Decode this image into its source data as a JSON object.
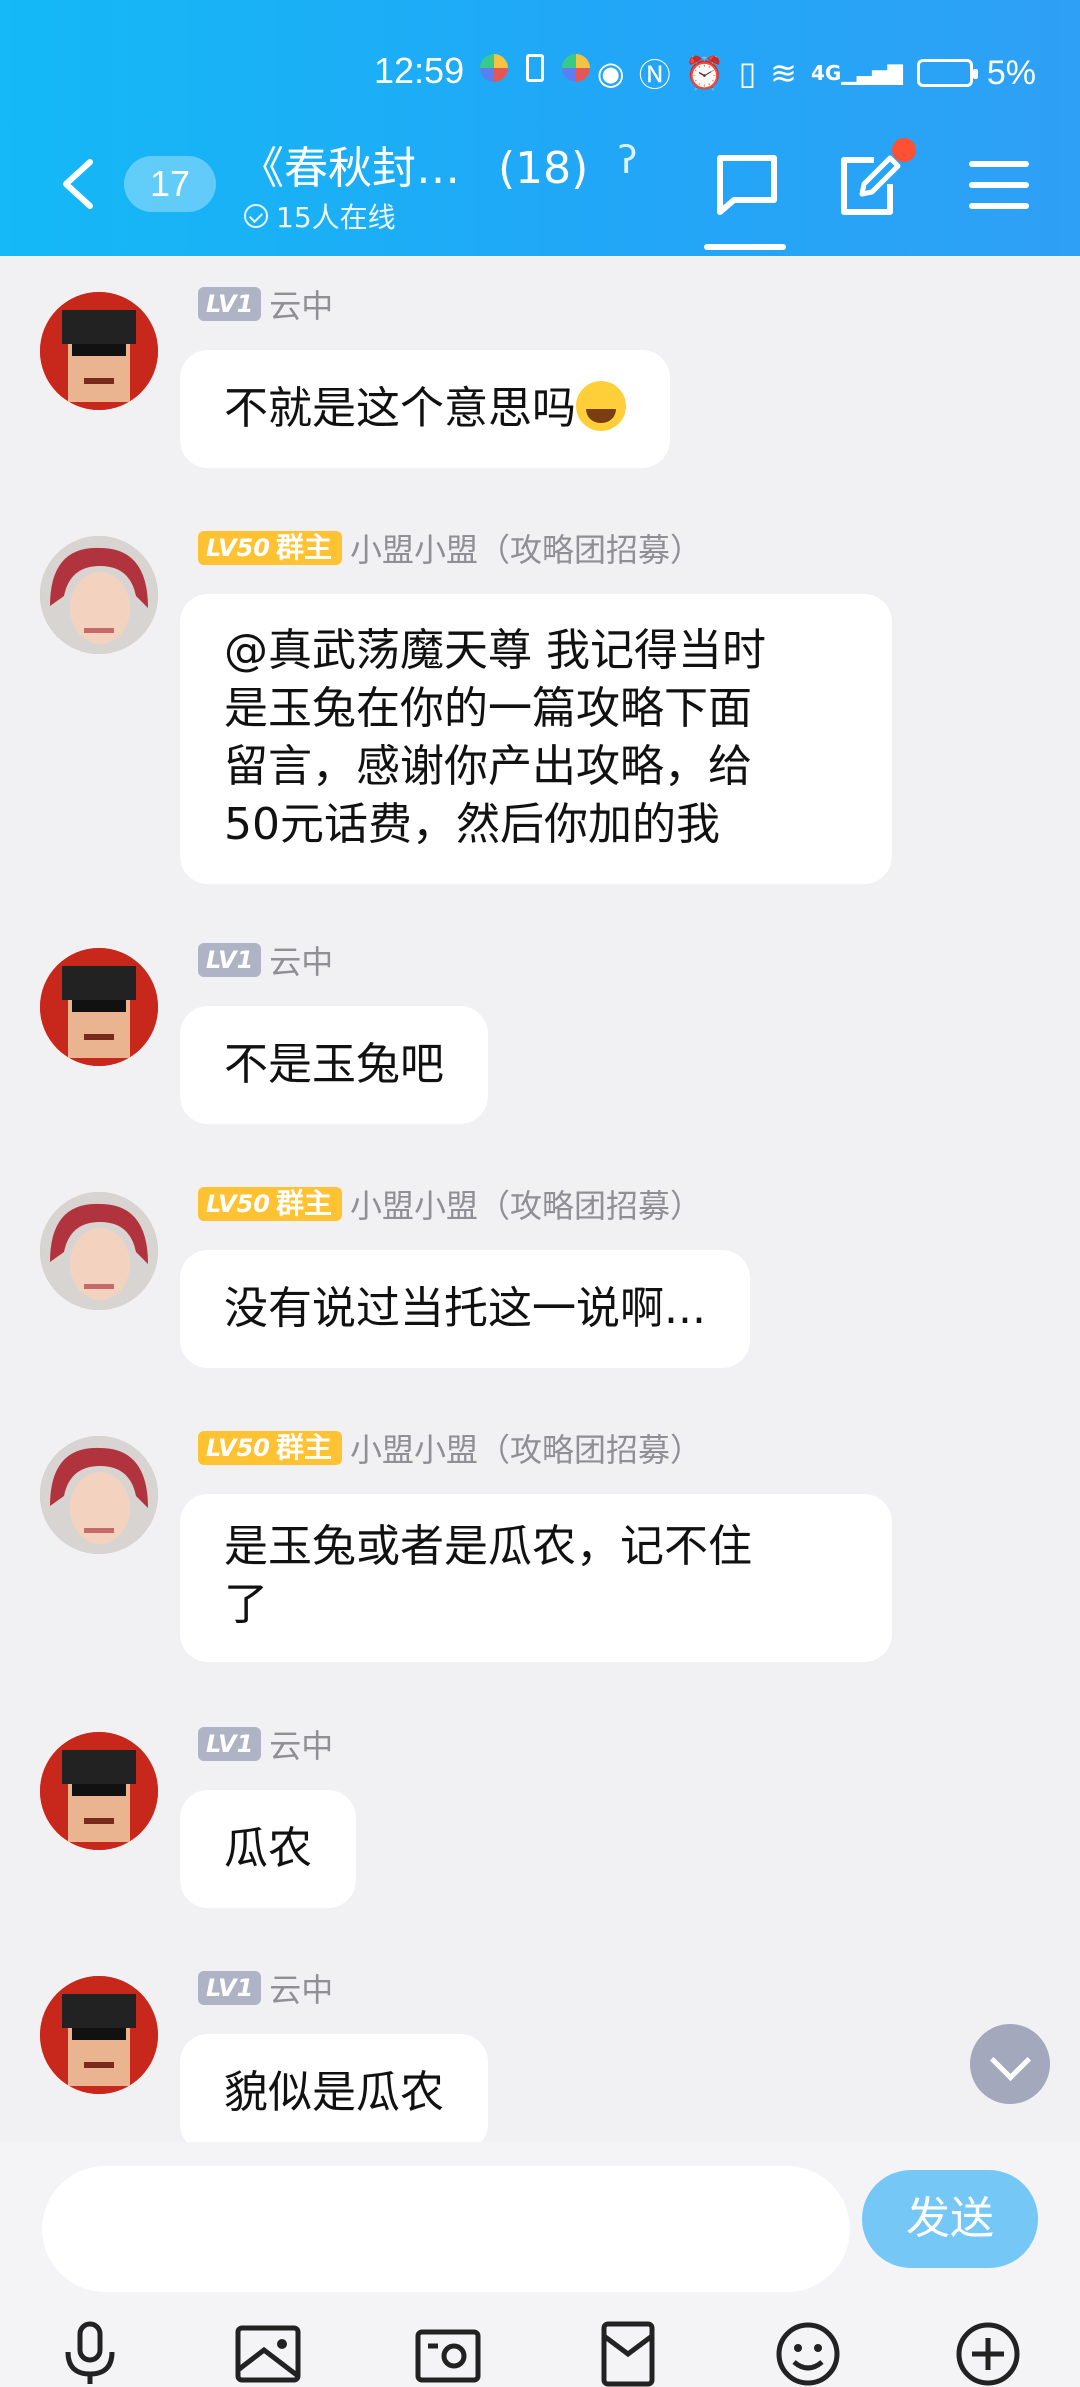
{
  "status_bar": {
    "time": "12:59",
    "network": "4G",
    "battery": "5%"
  },
  "header": {
    "unread_count": "17",
    "group_title": "《春秋封…",
    "member_count": "(18)",
    "online_text": "15人在线"
  },
  "messages": [
    {
      "level": "LV1",
      "nickname": "云中",
      "text": "不就是这个意思吗",
      "emoji": "laughing-crying"
    },
    {
      "level": "LV50",
      "role": "群主",
      "nickname": "小盟小盟（攻略团招募）",
      "lines": [
        "@真武荡魔天尊 我记得当时",
        "是玉兔在你的一篇攻略下面",
        "留言，感谢你产出攻略，给",
        "50元话费，然后你加的我"
      ]
    },
    {
      "level": "LV1",
      "nickname": "云中",
      "text": "不是玉兔吧"
    },
    {
      "level": "LV50",
      "role": "群主",
      "nickname": "小盟小盟（攻略团招募）",
      "text": "没有说过当托这一说啊..."
    },
    {
      "level": "LV50",
      "role": "群主",
      "nickname": "小盟小盟（攻略团招募）",
      "lines": [
        "是玉兔或者是瓜农，记不住",
        "了"
      ]
    },
    {
      "level": "LV1",
      "nickname": "云中",
      "text": "瓜农"
    },
    {
      "level": "LV1",
      "nickname": "云中",
      "text": "貌似是瓜农"
    }
  ],
  "composer": {
    "send_label": "发送",
    "input_value": ""
  },
  "toolbar_icons": [
    "microphone-icon",
    "image-icon",
    "camera-icon",
    "red-packet-icon",
    "emoji-icon",
    "plus-icon"
  ],
  "colors": {
    "header": "#1fb0f6",
    "send": "#75c7f6",
    "owner_badge": "#ffc233",
    "lv1_badge": "#aeb4c6"
  }
}
